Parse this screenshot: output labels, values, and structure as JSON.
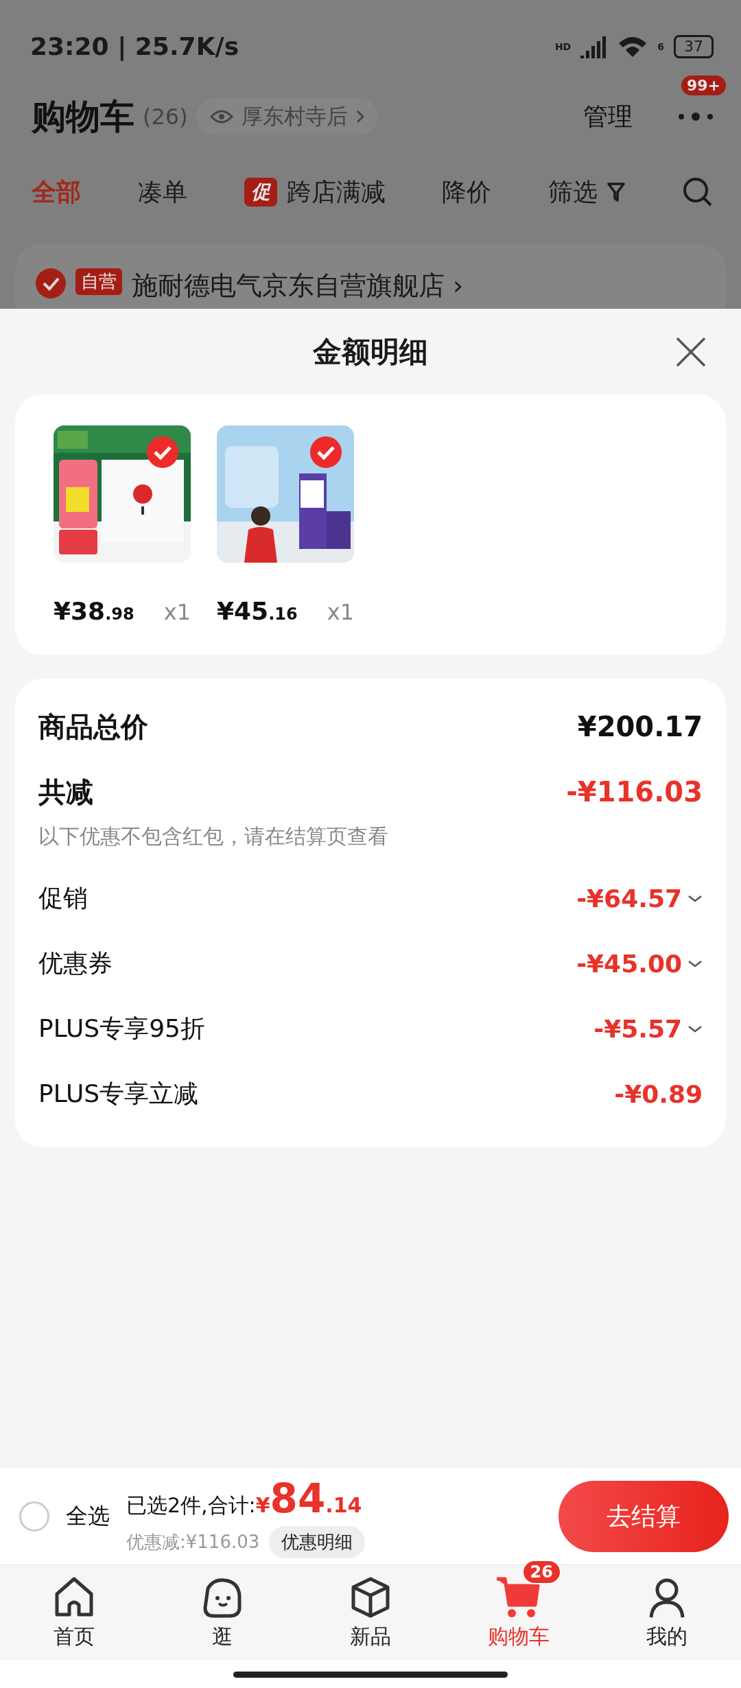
{
  "status_bar": {
    "time": "23:20 | 25.7K/s",
    "network": "HD",
    "wifi_gen": "6",
    "battery": "37"
  },
  "header": {
    "title": "购物车",
    "count": "(26)",
    "location": "厚东村寺后",
    "manage": "管理",
    "badge": "99+"
  },
  "filter_tabs": [
    {
      "label": "全部",
      "selected": true
    },
    {
      "label": "凑单",
      "selected": false
    },
    {
      "label": "跨店满减",
      "tag": "促",
      "selected": false
    },
    {
      "label": "降价",
      "selected": false
    },
    {
      "label": "筛选",
      "kind": "filter",
      "selected": false
    }
  ],
  "store": {
    "tag": "自营",
    "name": "施耐德电气京东自营旗舰店 ›"
  },
  "sheet": {
    "title": "金额明细"
  },
  "items": [
    {
      "price": "¥38",
      "cents": ".98",
      "qty": "x1",
      "checked": true,
      "kind": "switch"
    },
    {
      "price": "¥45",
      "cents": ".16",
      "qty": "x1",
      "checked": true,
      "kind": "milk"
    }
  ],
  "summary": {
    "total_label": "商品总价",
    "total_value": "¥200.17",
    "discount_label": "共减",
    "discount_value": "-¥116.03",
    "note": "以下优惠不包含红包，请在结算页查看",
    "rows": [
      {
        "label": "促销",
        "value": "-¥64.57",
        "expandable": true
      },
      {
        "label": "优惠券",
        "value": "-¥45.00",
        "expandable": true
      },
      {
        "label": "PLUS专享95折",
        "value": "-¥5.57",
        "expandable": true
      },
      {
        "label": "PLUS专享立减",
        "value": "-¥0.89",
        "expandable": false
      }
    ]
  },
  "checkout": {
    "select_all": {
      "label": "全选",
      "checked": false
    },
    "selected_text": "已选2件,合计:",
    "currency": "¥",
    "amount": "84",
    "cents": ".14",
    "savings": "优惠减:¥116.03",
    "detail_button": "优惠明细",
    "button": "去结算"
  },
  "nav": [
    {
      "label": "首页",
      "kind": "home",
      "selected": false
    },
    {
      "label": "逛",
      "kind": "stroll",
      "selected": false
    },
    {
      "label": "新品",
      "kind": "new",
      "selected": false
    },
    {
      "label": "购物车",
      "kind": "cart",
      "selected": true,
      "badge": "26"
    },
    {
      "label": "我的",
      "kind": "me",
      "selected": false
    }
  ]
}
